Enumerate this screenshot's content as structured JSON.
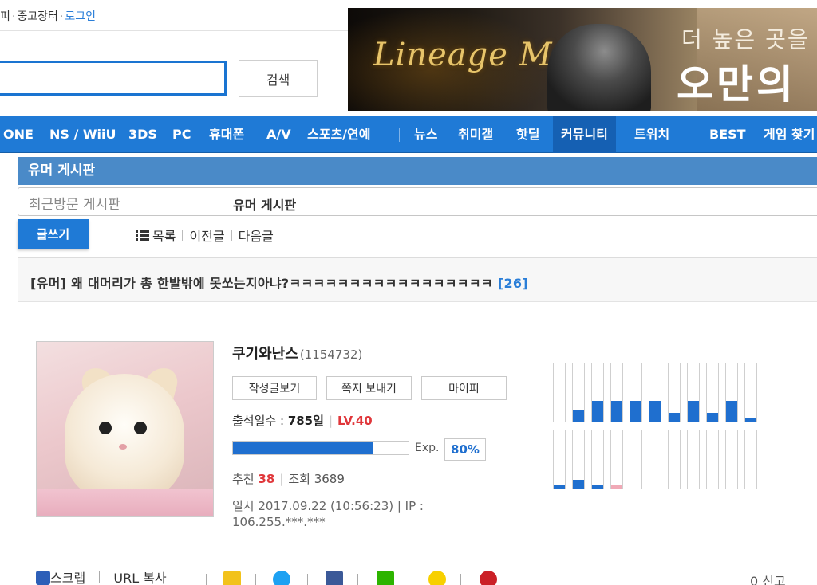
{
  "top_links": {
    "item1": "피",
    "item2": "중고장터",
    "login": "로그인"
  },
  "search": {
    "button_label": "검색",
    "value": ""
  },
  "banner": {
    "logo": "Lineage M",
    "headline_1": "더 높은 곳을 향",
    "headline_2": "오만의"
  },
  "nav": {
    "items": [
      "ONE",
      "NS / WiiU",
      "3DS",
      "PC",
      "휴대폰",
      "A/V",
      "스포츠/연예",
      "뉴스",
      "취미갤",
      "핫딜",
      "커뮤니티",
      "트위치",
      "BEST",
      "게임 찾기"
    ],
    "active": "커뮤니티"
  },
  "board": {
    "title": "유머 게시판",
    "recent_label": "최근방문 게시판",
    "recent_current": "유머 게시판",
    "write_button": "글쓰기",
    "list_link": "목록",
    "prev_link": "이전글",
    "next_link": "다음글"
  },
  "post": {
    "title": "[유머] 왜 대머리가 총 한발밖에 못쏘는지아냐?ㅋㅋㅋㅋㅋㅋㅋㅋㅋㅋㅋㅋㅋㅋㅋㅋㅋ",
    "comment_count": "[26]",
    "author": {
      "nickname": "쿠기와난스",
      "user_id": "(1154732)",
      "btn_posts": "작성글보기",
      "btn_message": "쪽지 보내기",
      "btn_mypi": "마이피",
      "attendance_label": "출석일수 :",
      "attendance_value": "785일",
      "level": "LV.40",
      "exp_label": "Exp.",
      "exp_percent": "80%",
      "exp_fraction": 0.8
    },
    "recommend_label": "추천",
    "recommend_value": "38",
    "views_label": "조회",
    "views_value": "3689",
    "date_ip": "일시 2017.09.22 (10:56:23) | IP : 106.255.***.***"
  },
  "activity_chart": {
    "top_row": [
      0,
      0.2,
      0.35,
      0.35,
      0.35,
      0.35,
      0.15,
      0.35,
      0.15,
      0.35,
      0.05,
      0
    ],
    "bottom_row": [
      0.05,
      0.15,
      0.05,
      0.05,
      0,
      0,
      0,
      0,
      0,
      0,
      0,
      0
    ],
    "bottom_pink_index": 3,
    "colors": {
      "fill": "#1f6fcf",
      "pink": "#f0a9b6"
    }
  },
  "share": {
    "scrap": "스크랩",
    "url_copy": "URL 복사",
    "report": "0 신고"
  },
  "colors": {
    "accent": "#1f7ad6",
    "level_red": "#e0363a",
    "link_blue": "#2a7ed8"
  }
}
